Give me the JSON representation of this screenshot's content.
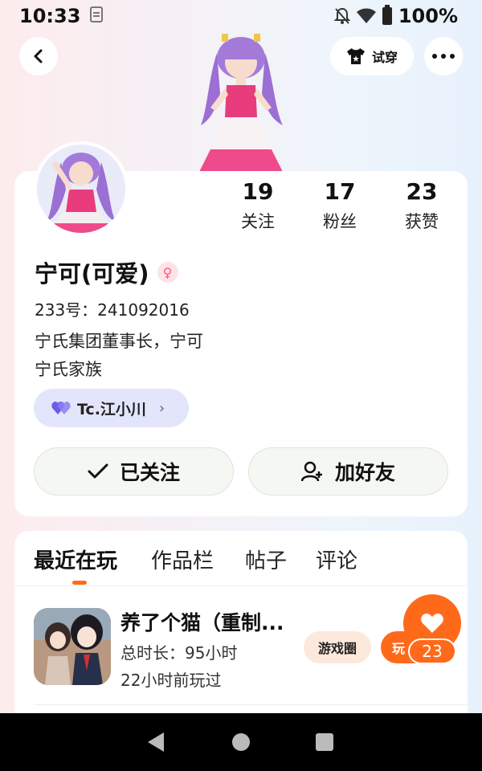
{
  "status_bar": {
    "time": "10:33",
    "battery": "100%"
  },
  "header": {
    "try_on_label": "试穿"
  },
  "profile": {
    "stats": [
      {
        "value": "19",
        "label": "关注"
      },
      {
        "value": "17",
        "label": "粉丝"
      },
      {
        "value": "23",
        "label": "获赞"
      }
    ],
    "name": "宁可(可爱)",
    "gender_symbol": "♀",
    "id_line": "233号：241092016",
    "bio_lines": [
      "宁氏集团董事长，宁可",
      "宁氏家族"
    ],
    "guild_label": "Tc.江小川",
    "followed_label": "已关注",
    "add_friend_label": "加好友"
  },
  "tabs": [
    "最近在玩",
    "作品栏",
    "帖子",
    "评论"
  ],
  "recent_game": {
    "title": "养了个猫（重制...",
    "duration": "总时长：95小时",
    "last_played": "22小时前玩过",
    "circle_label": "游戏圈",
    "play_label": "玩"
  },
  "like": {
    "count": "23"
  },
  "colors": {
    "accent": "#ff6a1a",
    "guild_bg": "#e3e6fb",
    "card_bg": "#ffffff"
  }
}
